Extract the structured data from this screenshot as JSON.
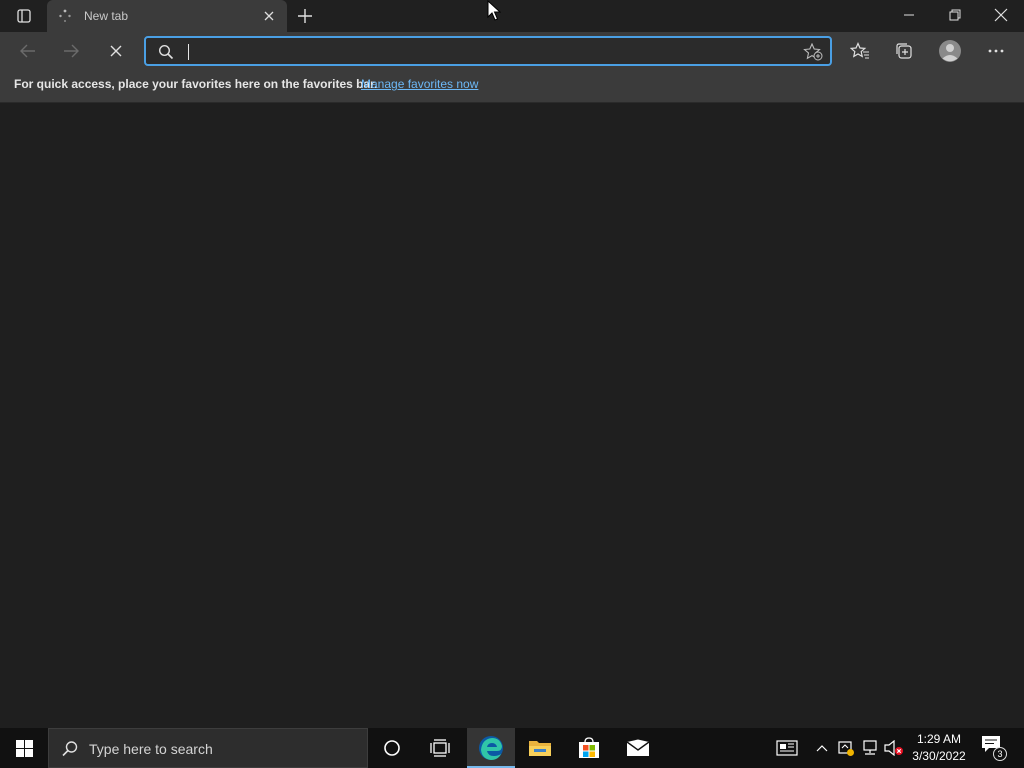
{
  "tab": {
    "title": "New tab"
  },
  "address_bar": {
    "value": "",
    "placeholder": ""
  },
  "favorites_bar": {
    "message": "For quick access, place your favorites here on the favorites bar.",
    "link_label": "Manage favorites now"
  },
  "taskbar": {
    "search_placeholder": "Type here to search",
    "clock_time": "1:29 AM",
    "clock_date": "3/30/2022",
    "notification_count": "3"
  },
  "colors": {
    "accent": "#4a9fe4",
    "link": "#6cb8f6",
    "background": "#1f1f1f",
    "toolbar": "#3b3b3b",
    "taskbar": "#111111"
  },
  "icons": {
    "tab_actions": "tab-actions-icon",
    "tab_loading": "loading-spinner-icon",
    "tab_close": "close-icon",
    "new_tab": "plus-icon",
    "minimize": "minimize-icon",
    "restore": "restore-icon",
    "window_close": "close-icon",
    "back": "arrow-left-icon",
    "forward": "arrow-right-icon",
    "stop": "stop-icon",
    "search": "search-icon",
    "add_favorite": "star-add-icon",
    "favorites": "favorites-icon",
    "collections": "collections-icon",
    "profile": "profile-icon",
    "more": "ellipsis-icon",
    "start": "windows-icon",
    "cortana": "cortana-icon",
    "task_view": "task-view-icon",
    "edge": "edge-icon",
    "file_explorer": "folder-icon",
    "store": "store-icon",
    "mail": "mail-icon",
    "news": "news-icon",
    "show_hidden": "chevron-up-icon",
    "network": "network-icon",
    "volume": "volume-muted-icon",
    "action_center": "notification-icon"
  }
}
